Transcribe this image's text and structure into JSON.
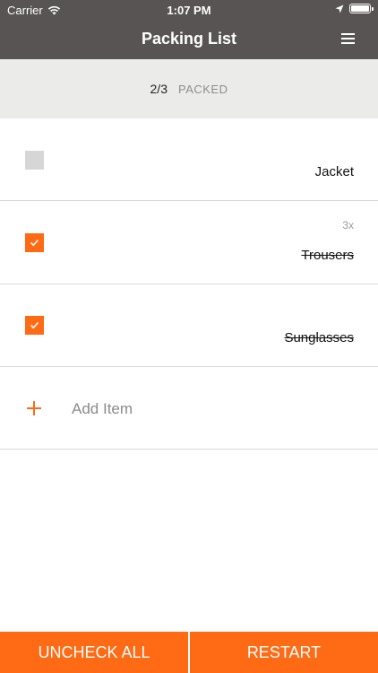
{
  "status_bar": {
    "carrier": "Carrier",
    "time": "1:07 PM",
    "icons": [
      "wifi-icon",
      "location-arrow-icon",
      "battery-icon"
    ]
  },
  "nav": {
    "title": "Packing List",
    "menu_icon": "hamburger-menu-icon"
  },
  "summary": {
    "count": "2/3",
    "label": "PACKED"
  },
  "items": [
    {
      "name": "Jacket",
      "checked": false,
      "quantity": ""
    },
    {
      "name": "Trousers",
      "checked": true,
      "quantity": "3x"
    },
    {
      "name": "Sunglasses",
      "checked": true,
      "quantity": ""
    }
  ],
  "add_item": {
    "label": "Add Item",
    "icon": "plus-icon"
  },
  "footer": {
    "uncheck_all": "UNCHECK ALL",
    "restart": "RESTART"
  },
  "colors": {
    "accent": "#ff6a14",
    "nav_background": "#575453",
    "summary_background": "#ebebe9"
  }
}
